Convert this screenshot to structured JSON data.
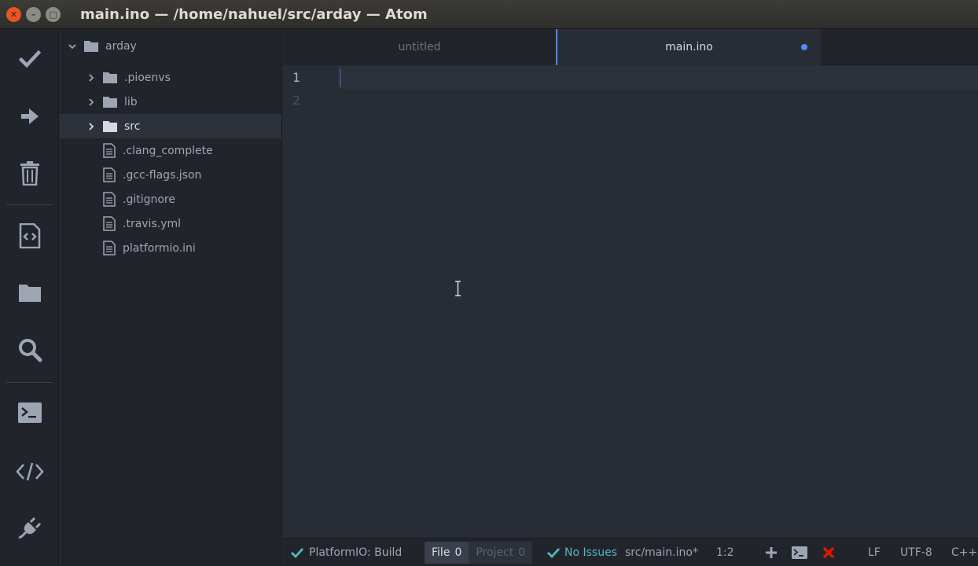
{
  "window": {
    "title": "main.ino — /home/nahuel/src/arday — Atom",
    "buttons": [
      "close",
      "minimize",
      "maximize"
    ]
  },
  "toolbar": {
    "items": [
      {
        "name": "build",
        "icon": "check-icon"
      },
      {
        "name": "upload",
        "icon": "arrow-right-icon"
      },
      {
        "name": "clean",
        "icon": "trash-icon"
      },
      {
        "name": "home",
        "icon": "file-code-icon"
      },
      {
        "name": "open-project",
        "icon": "folder-icon"
      },
      {
        "name": "find",
        "icon": "search-icon"
      },
      {
        "name": "terminal",
        "icon": "terminal-icon"
      },
      {
        "name": "serial-monitor",
        "icon": "code-icon"
      },
      {
        "name": "settings",
        "icon": "plug-icon"
      }
    ]
  },
  "tree": {
    "root": "arday",
    "items": [
      {
        "label": ".pioenvs",
        "type": "folder",
        "selected": false
      },
      {
        "label": "lib",
        "type": "folder",
        "selected": false
      },
      {
        "label": "src",
        "type": "folder",
        "selected": true
      },
      {
        "label": ".clang_complete",
        "type": "file"
      },
      {
        "label": ".gcc-flags.json",
        "type": "file"
      },
      {
        "label": ".gitignore",
        "type": "file"
      },
      {
        "label": ".travis.yml",
        "type": "file"
      },
      {
        "label": "platformio.ini",
        "type": "file"
      }
    ]
  },
  "tabs": [
    {
      "label": "untitled",
      "active": false,
      "modified": false
    },
    {
      "label": "main.ino",
      "active": true,
      "modified": true
    }
  ],
  "editor": {
    "line_numbers": [
      "1",
      "2"
    ],
    "current_line": 1,
    "lines": [
      "",
      ""
    ]
  },
  "statusbar": {
    "build_label": "PlatformIO: Build",
    "file_label": "File",
    "file_count": "0",
    "project_label": "Project",
    "project_count": "0",
    "issues_label": "No Issues",
    "file_path": "src/main.ino*",
    "cursor_position": "1:2",
    "line_ending": "LF",
    "encoding": "UTF-8",
    "grammar": "C++"
  },
  "colors": {
    "accent": "#528bff",
    "success": "#56b6c2",
    "error": "#e51400",
    "ubuntu_close": "#e95420"
  }
}
